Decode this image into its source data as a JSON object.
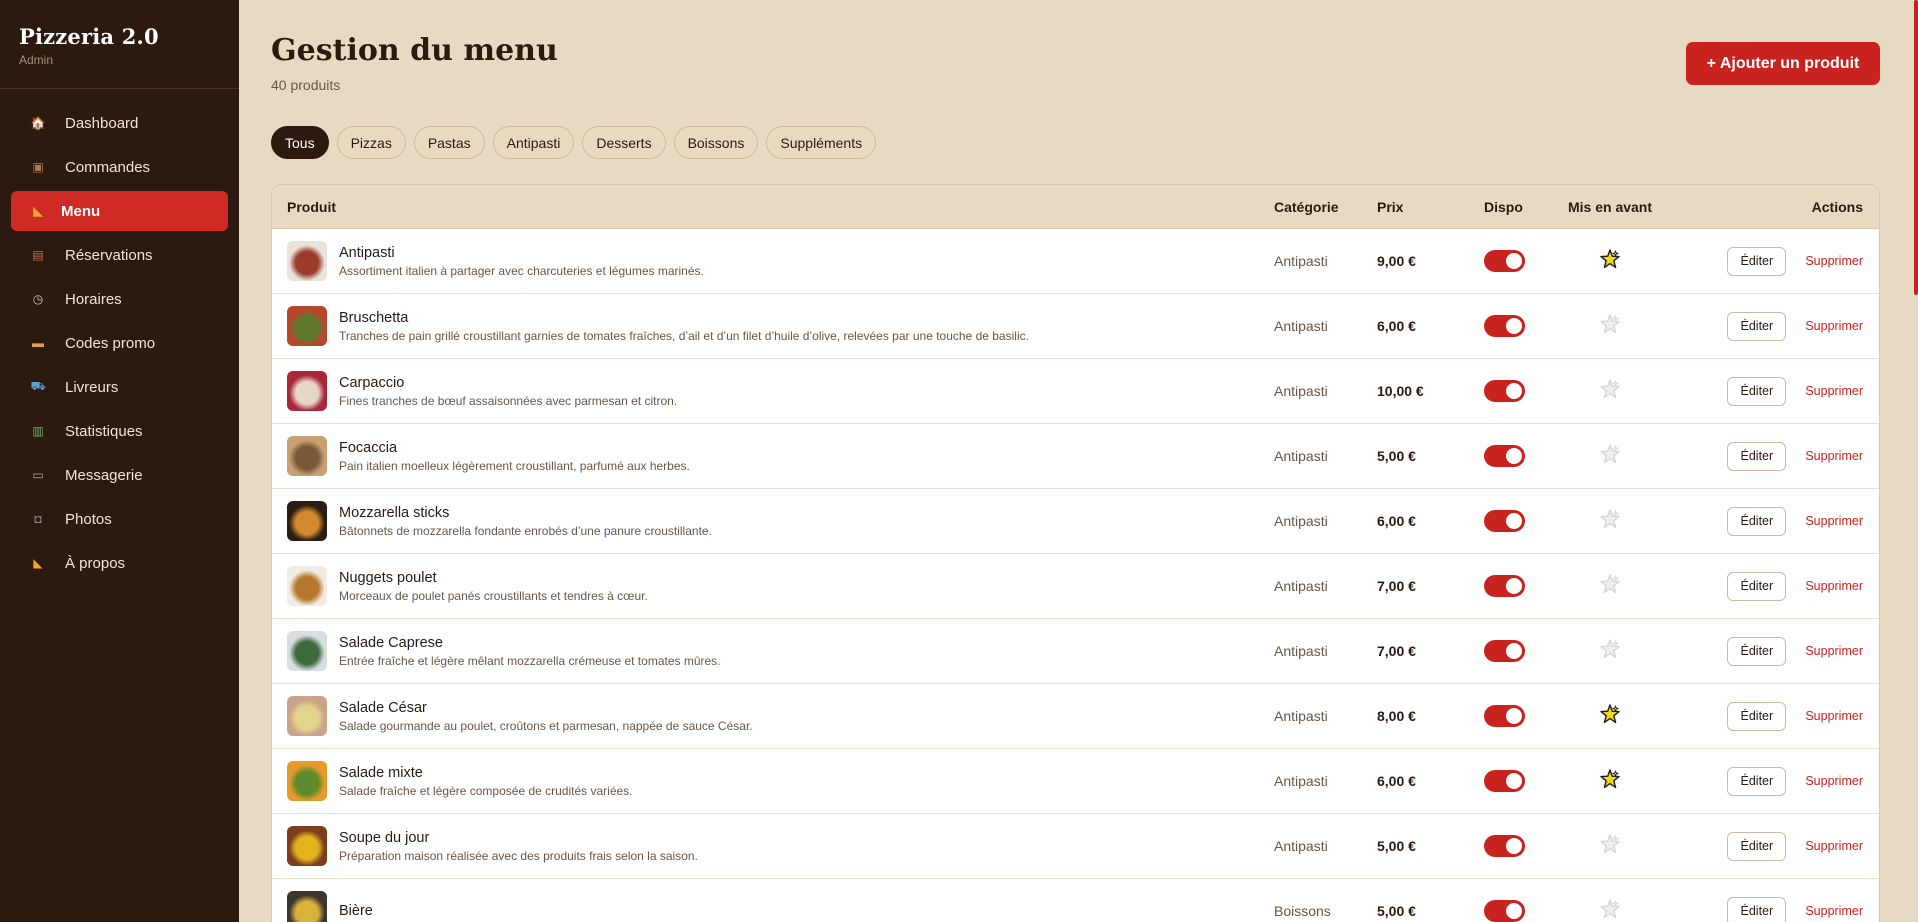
{
  "sidebar": {
    "brand": "Pizzeria 2.0",
    "role": "Admin",
    "items": [
      {
        "label": "Dashboard",
        "icon": "home-icon",
        "glyph": "🏠",
        "color": "#e0a25a"
      },
      {
        "label": "Commandes",
        "icon": "box-icon",
        "glyph": "▣",
        "color": "#b07a4a"
      },
      {
        "label": "Menu",
        "icon": "pizza-icon",
        "glyph": "◣",
        "color": "#f4a52a",
        "active": true
      },
      {
        "label": "Réservations",
        "icon": "calendar-icon",
        "glyph": "▤",
        "color": "#c96b55"
      },
      {
        "label": "Horaires",
        "icon": "clock-icon",
        "glyph": "◷",
        "color": "#d9c7b2"
      },
      {
        "label": "Codes promo",
        "icon": "ticket-icon",
        "glyph": "▬",
        "color": "#e0a23a"
      },
      {
        "label": "Livreurs",
        "icon": "scooter-icon",
        "glyph": "⛟",
        "color": "#5aa0d8"
      },
      {
        "label": "Statistiques",
        "icon": "bar-chart-icon",
        "glyph": "▥",
        "color": "#6fb06a"
      },
      {
        "label": "Messagerie",
        "icon": "chat-icon",
        "glyph": "▭",
        "color": "#b8a898"
      },
      {
        "label": "Photos",
        "icon": "camera-icon",
        "glyph": "◘",
        "color": "#8a8a8a"
      },
      {
        "label": "À propos",
        "icon": "pizza-slice-icon",
        "glyph": "◣",
        "color": "#f4a52a"
      }
    ]
  },
  "header": {
    "title": "Gestion du menu",
    "count": "40 produits",
    "add_label": "+ Ajouter un produit"
  },
  "tabs": [
    "Tous",
    "Pizzas",
    "Pastas",
    "Antipasti",
    "Desserts",
    "Boissons",
    "Suppléments"
  ],
  "active_tab": "Tous",
  "table": {
    "columns": {
      "product": "Produit",
      "category": "Catégorie",
      "price": "Prix",
      "dispo": "Dispo",
      "featured": "Mis en avant",
      "actions": "Actions"
    },
    "edit_label": "Éditer",
    "delete_label": "Supprimer",
    "rows": [
      {
        "name": "Antipasti",
        "desc": "Assortiment italien à partager avec charcuteries et légumes marinés.",
        "category": "Antipasti",
        "price": "9,00 €",
        "dispo": true,
        "featured": true,
        "thumb": [
          "#e9e3dc",
          "#9b3b2a"
        ]
      },
      {
        "name": "Bruschetta",
        "desc": "Tranches de pain grillé croustillant garnies de tomates fraîches, d’ail et d’un filet d’huile d’olive, relevées par une touche de basilic.",
        "category": "Antipasti",
        "price": "6,00 €",
        "dispo": true,
        "featured": false,
        "thumb": [
          "#b6472b",
          "#5f7a2e"
        ]
      },
      {
        "name": "Carpaccio",
        "desc": "Fines tranches de bœuf assaisonnées avec parmesan et citron.",
        "category": "Antipasti",
        "price": "10,00 €",
        "dispo": true,
        "featured": false,
        "thumb": [
          "#a8273a",
          "#e6d6c8"
        ]
      },
      {
        "name": "Focaccia",
        "desc": "Pain italien moelleux légèrement croustillant, parfumé aux herbes.",
        "category": "Antipasti",
        "price": "5,00 €",
        "dispo": true,
        "featured": false,
        "thumb": [
          "#c9a072",
          "#7a5838"
        ]
      },
      {
        "name": "Mozzarella sticks",
        "desc": "Bâtonnets de mozzarella fondante enrobés d’une panure croustillante.",
        "category": "Antipasti",
        "price": "6,00 €",
        "dispo": true,
        "featured": false,
        "thumb": [
          "#2b1d14",
          "#d28a2c"
        ]
      },
      {
        "name": "Nuggets poulet",
        "desc": "Morceaux de poulet panés croustillants et tendres à cœur.",
        "category": "Antipasti",
        "price": "7,00 €",
        "dispo": true,
        "featured": false,
        "thumb": [
          "#f0ebe4",
          "#b6782e"
        ]
      },
      {
        "name": "Salade Caprese",
        "desc": "Entrée fraîche et légère mêlant mozzarella crémeuse et tomates mûres.",
        "category": "Antipasti",
        "price": "7,00 €",
        "dispo": true,
        "featured": false,
        "thumb": [
          "#d8dde3",
          "#3d6a3a"
        ]
      },
      {
        "name": "Salade César",
        "desc": "Salade gourmande au poulet, croûtons et parmesan, nappée de sauce César.",
        "category": "Antipasti",
        "price": "8,00 €",
        "dispo": true,
        "featured": true,
        "thumb": [
          "#c9a48a",
          "#e2d48a"
        ]
      },
      {
        "name": "Salade mixte",
        "desc": "Salade fraîche et légère composée de crudités variées.",
        "category": "Antipasti",
        "price": "6,00 €",
        "dispo": true,
        "featured": true,
        "thumb": [
          "#e59a2a",
          "#5d8b2e"
        ]
      },
      {
        "name": "Soupe du jour",
        "desc": "Préparation maison réalisée avec des produits frais selon la saison.",
        "category": "Antipasti",
        "price": "5,00 €",
        "dispo": true,
        "featured": false,
        "thumb": [
          "#7a3e1e",
          "#e6b11f"
        ]
      },
      {
        "name": "Bière",
        "desc": "",
        "category": "Boissons",
        "price": "5,00 €",
        "dispo": true,
        "featured": false,
        "thumb": [
          "#3b3630",
          "#d9b23a"
        ]
      }
    ]
  }
}
